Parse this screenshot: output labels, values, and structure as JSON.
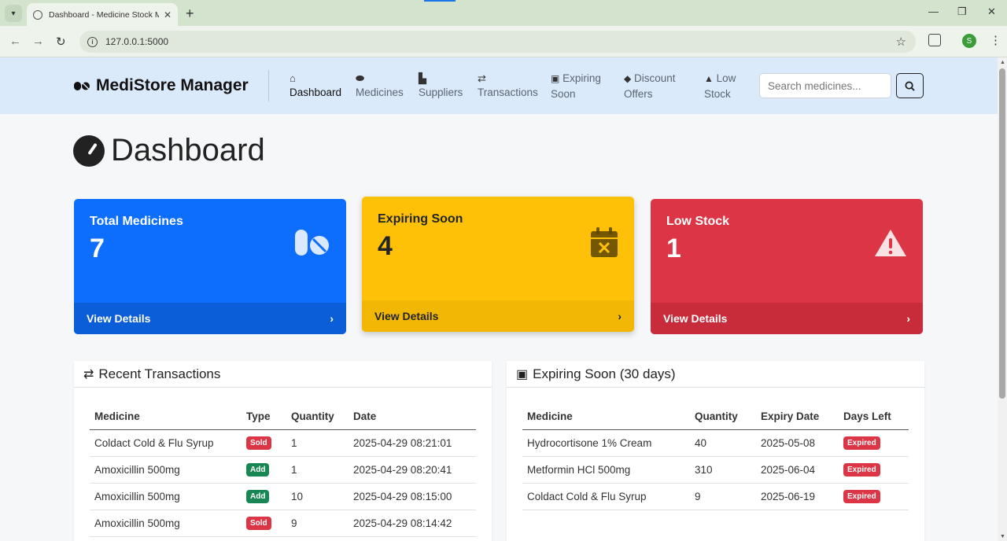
{
  "browser": {
    "tab_title": "Dashboard - Medicine Stock Ma",
    "url": "127.0.0.1:5000",
    "profile_initial": "S"
  },
  "navbar": {
    "brand": "MediStore Manager",
    "items": [
      {
        "label": "Dashboard",
        "icon": "home-icon"
      },
      {
        "label": "Medicines",
        "icon": "pills-icon"
      },
      {
        "label": "Suppliers",
        "icon": "truck-icon"
      },
      {
        "label": "Transactions",
        "icon": "exchange-icon"
      },
      {
        "label": "Expiring",
        "label2": "Soon",
        "icon": "calendar-x-icon"
      },
      {
        "label": "Discount",
        "label2": "Offers",
        "icon": "tag-icon"
      },
      {
        "label": "Low",
        "label2": "Stock",
        "icon": "warning-icon"
      }
    ],
    "search_placeholder": "Search medicines..."
  },
  "page_title": "Dashboard",
  "cards": [
    {
      "label": "Total Medicines",
      "value": "7",
      "footer": "View Details",
      "color": "#0d6efd"
    },
    {
      "label": "Expiring Soon",
      "value": "4",
      "footer": "View Details",
      "color": "#ffc107"
    },
    {
      "label": "Low Stock",
      "value": "1",
      "footer": "View Details",
      "color": "#dc3545"
    }
  ],
  "recent_transactions": {
    "title": "Recent Transactions",
    "columns": [
      "Medicine",
      "Type",
      "Quantity",
      "Date"
    ],
    "rows": [
      {
        "medicine": "Coldact Cold & Flu Syrup",
        "type": "Sold",
        "quantity": "1",
        "date": "2025-04-29 08:21:01"
      },
      {
        "medicine": "Amoxicillin 500mg",
        "type": "Add",
        "quantity": "1",
        "date": "2025-04-29 08:20:41"
      },
      {
        "medicine": "Amoxicillin 500mg",
        "type": "Add",
        "quantity": "10",
        "date": "2025-04-29 08:15:00"
      },
      {
        "medicine": "Amoxicillin 500mg",
        "type": "Sold",
        "quantity": "9",
        "date": "2025-04-29 08:14:42"
      }
    ]
  },
  "expiring_soon": {
    "title": "Expiring Soon (30 days)",
    "columns": [
      "Medicine",
      "Quantity",
      "Expiry Date",
      "Days Left"
    ],
    "rows": [
      {
        "medicine": "Hydrocortisone 1% Cream",
        "quantity": "40",
        "expiry": "2025-05-08",
        "days_left": "Expired"
      },
      {
        "medicine": "Metformin HCl 500mg",
        "quantity": "310",
        "expiry": "2025-06-04",
        "days_left": "Expired"
      },
      {
        "medicine": "Coldact Cold & Flu Syrup",
        "quantity": "9",
        "expiry": "2025-06-19",
        "days_left": "Expired"
      }
    ]
  }
}
